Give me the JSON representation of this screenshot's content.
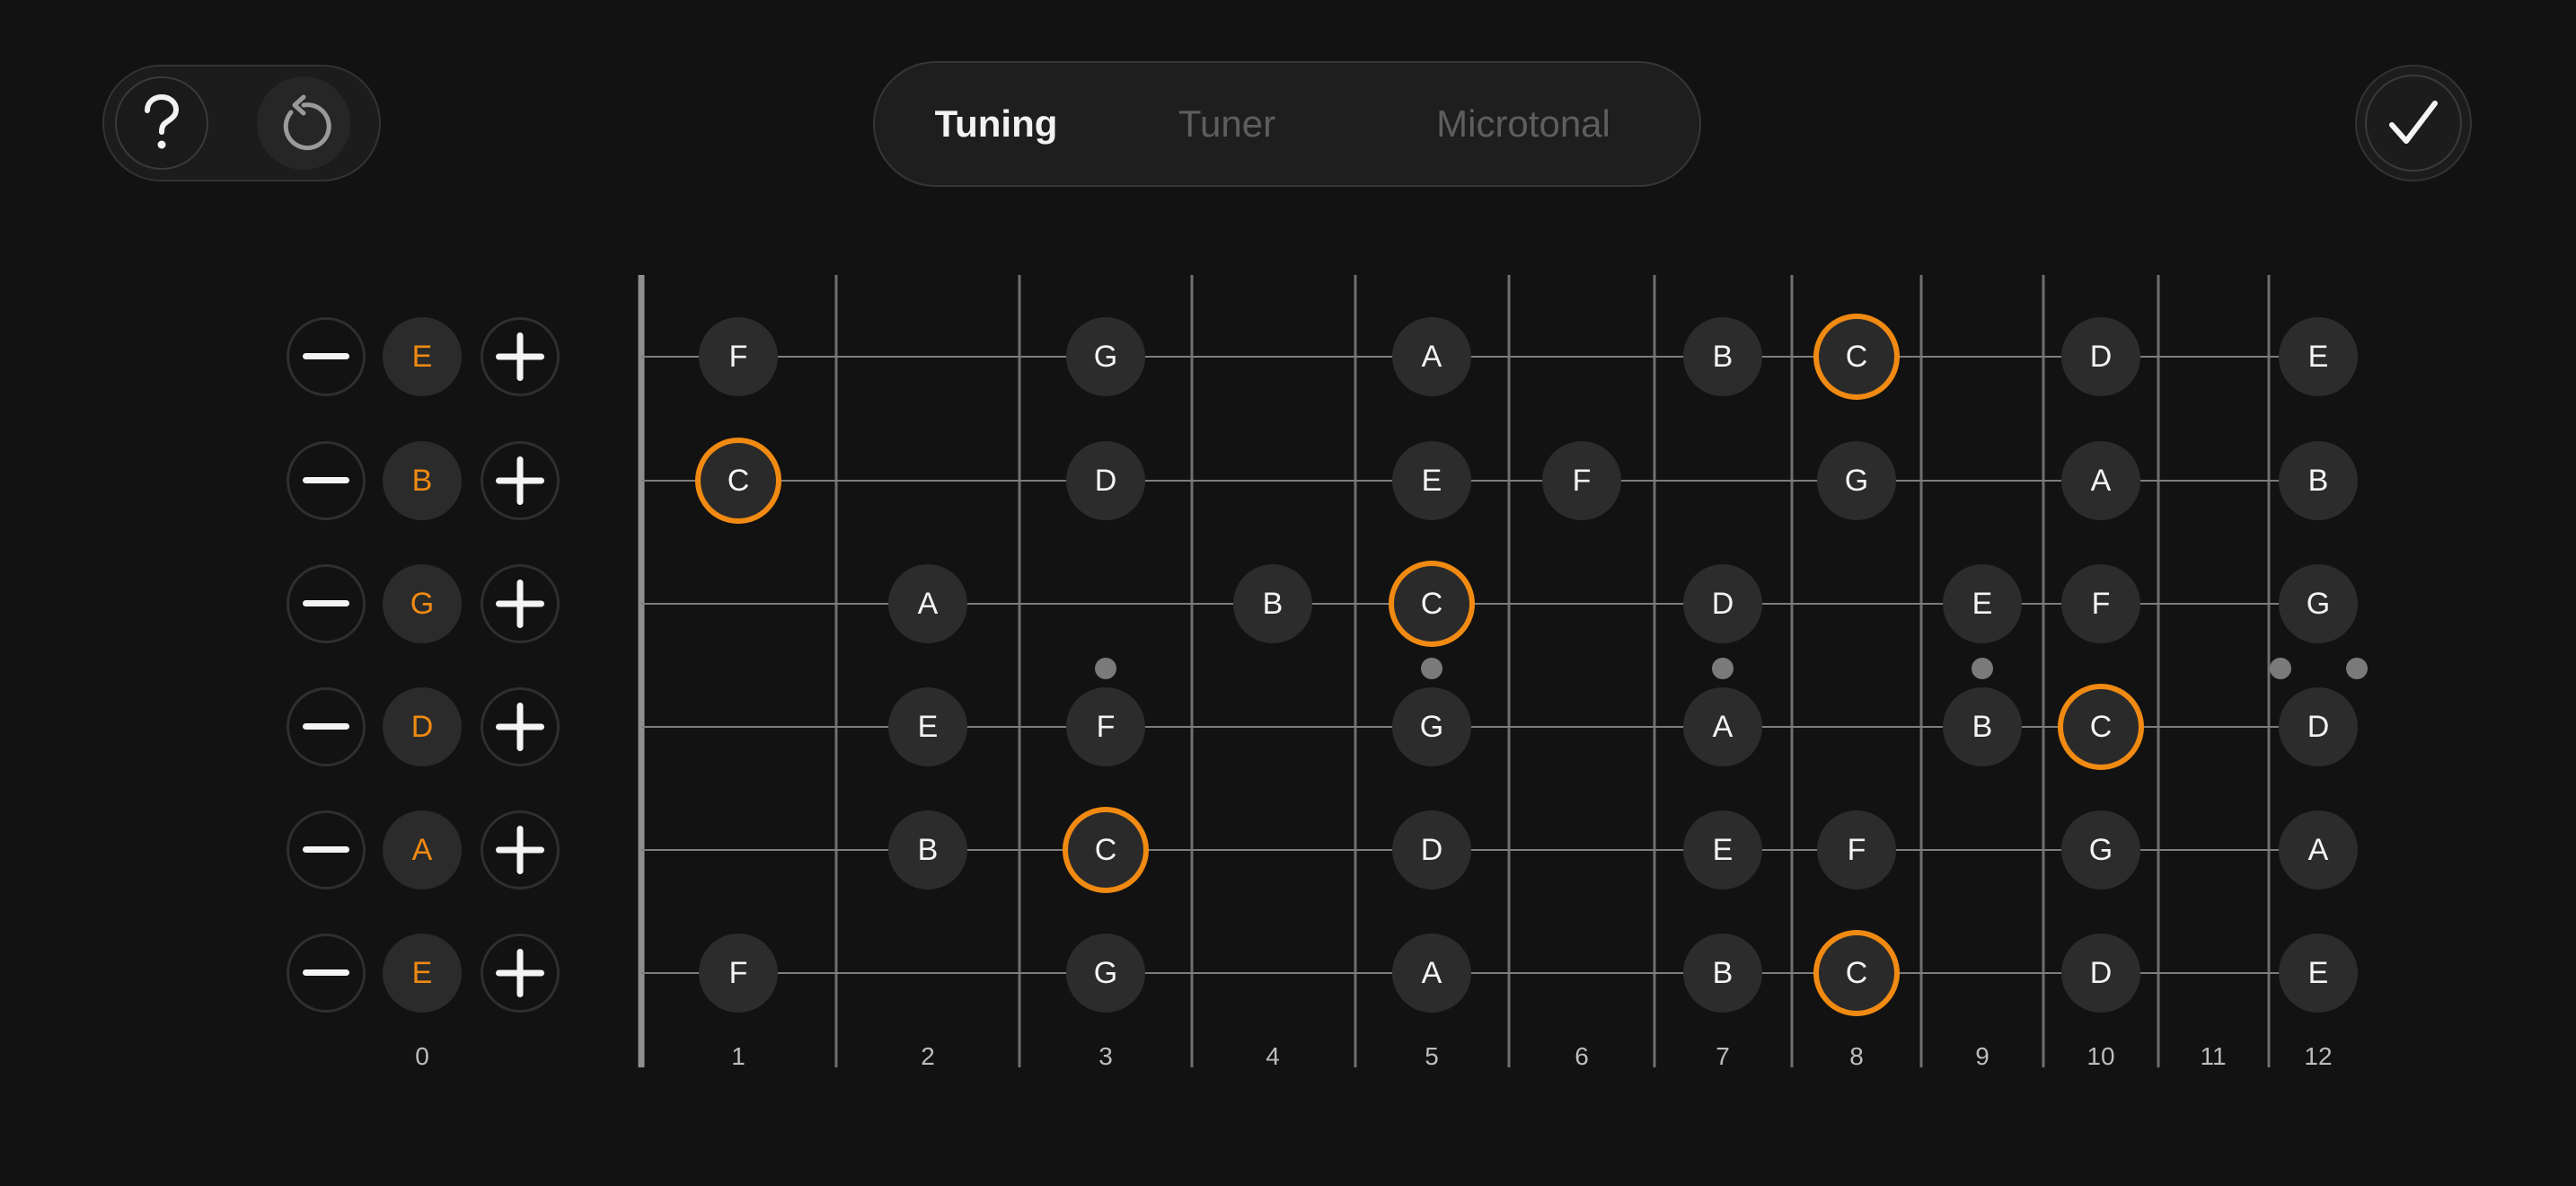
{
  "header": {
    "help_icon": "question-mark-icon",
    "reset_icon": "rotate-ccw-icon",
    "confirm_icon": "checkmark-icon",
    "tabs": [
      {
        "label": "Tuning",
        "active": true
      },
      {
        "label": "Tuner",
        "active": false
      },
      {
        "label": "Microtonal",
        "active": false
      }
    ]
  },
  "colors": {
    "background": "#121212",
    "accent": "#f08a12",
    "note_fill": "#2c2c2c",
    "fret_line": "#8a8a8a"
  },
  "strings": [
    {
      "tuning": "E",
      "notes": [
        {
          "fret": 1,
          "n": "F"
        },
        {
          "fret": 3,
          "n": "G"
        },
        {
          "fret": 5,
          "n": "A"
        },
        {
          "fret": 7,
          "n": "B"
        },
        {
          "fret": 8,
          "n": "C",
          "hl": true
        },
        {
          "fret": 10,
          "n": "D"
        },
        {
          "fret": 12,
          "n": "E"
        }
      ]
    },
    {
      "tuning": "B",
      "notes": [
        {
          "fret": 1,
          "n": "C",
          "hl": true
        },
        {
          "fret": 3,
          "n": "D"
        },
        {
          "fret": 5,
          "n": "E"
        },
        {
          "fret": 6,
          "n": "F"
        },
        {
          "fret": 8,
          "n": "G"
        },
        {
          "fret": 10,
          "n": "A"
        },
        {
          "fret": 12,
          "n": "B"
        }
      ]
    },
    {
      "tuning": "G",
      "notes": [
        {
          "fret": 2,
          "n": "A"
        },
        {
          "fret": 4,
          "n": "B"
        },
        {
          "fret": 5,
          "n": "C",
          "hl": true
        },
        {
          "fret": 7,
          "n": "D"
        },
        {
          "fret": 9,
          "n": "E"
        },
        {
          "fret": 10,
          "n": "F"
        },
        {
          "fret": 12,
          "n": "G"
        }
      ]
    },
    {
      "tuning": "D",
      "notes": [
        {
          "fret": 2,
          "n": "E"
        },
        {
          "fret": 3,
          "n": "F"
        },
        {
          "fret": 5,
          "n": "G"
        },
        {
          "fret": 7,
          "n": "A"
        },
        {
          "fret": 9,
          "n": "B"
        },
        {
          "fret": 10,
          "n": "C",
          "hl": true
        },
        {
          "fret": 12,
          "n": "D"
        }
      ]
    },
    {
      "tuning": "A",
      "notes": [
        {
          "fret": 2,
          "n": "B"
        },
        {
          "fret": 3,
          "n": "C",
          "hl": true
        },
        {
          "fret": 5,
          "n": "D"
        },
        {
          "fret": 7,
          "n": "E"
        },
        {
          "fret": 8,
          "n": "F"
        },
        {
          "fret": 10,
          "n": "G"
        },
        {
          "fret": 12,
          "n": "A"
        }
      ]
    },
    {
      "tuning": "E",
      "notes": [
        {
          "fret": 1,
          "n": "F"
        },
        {
          "fret": 3,
          "n": "G"
        },
        {
          "fret": 5,
          "n": "A"
        },
        {
          "fret": 7,
          "n": "B"
        },
        {
          "fret": 8,
          "n": "C",
          "hl": true
        },
        {
          "fret": 10,
          "n": "D"
        },
        {
          "fret": 12,
          "n": "E"
        }
      ]
    }
  ],
  "fret_numbers": [
    "0",
    "1",
    "2",
    "3",
    "4",
    "5",
    "6",
    "7",
    "8",
    "9",
    "10",
    "11",
    "12"
  ],
  "inlay_frets": [
    3,
    5,
    7,
    9,
    12
  ]
}
